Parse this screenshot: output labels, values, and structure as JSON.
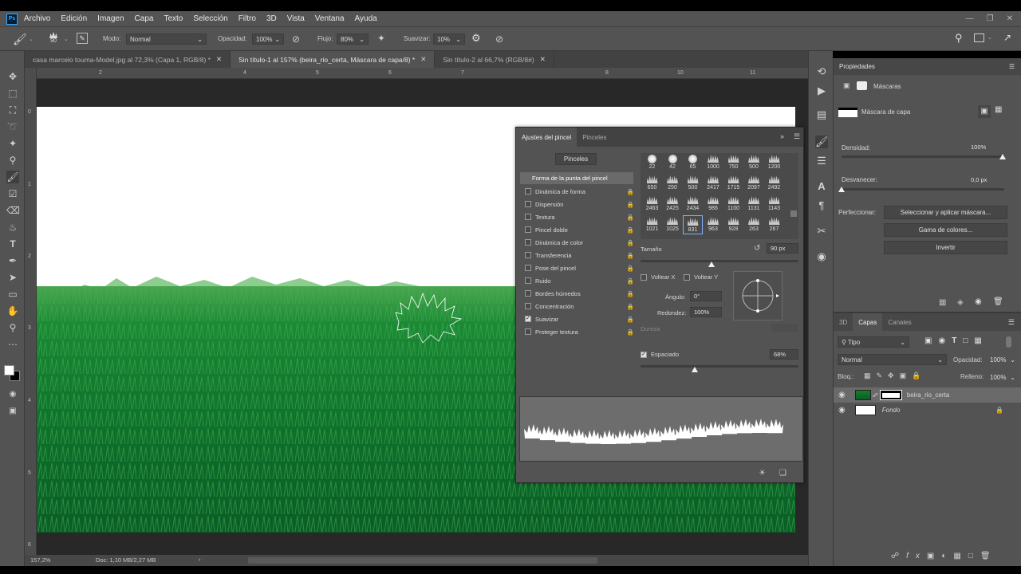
{
  "menu": {
    "app_icon": "Ps",
    "items": [
      "Archivo",
      "Edición",
      "Imagen",
      "Capa",
      "Texto",
      "Selección",
      "Filtro",
      "3D",
      "Vista",
      "Ventana",
      "Ayuda"
    ]
  },
  "options": {
    "brush_size": "90",
    "mode_label": "Modo:",
    "mode_value": "Normal",
    "opacity_label": "Opacidad:",
    "opacity_value": "100%",
    "flow_label": "Flujo:",
    "flow_value": "80%",
    "smoothing_label": "Suavizar:",
    "smoothing_value": "10%"
  },
  "tabs": [
    {
      "label": "casa marcelo touma-Model.jpg al 72,3% (Capa 1, RGB/8) *"
    },
    {
      "label": "Sin título-1 al 157% (beira_rio_certa, Máscara de capa/8) *"
    },
    {
      "label": "Sin título-2 al 66,7% (RGB/8#)"
    }
  ],
  "rulers": {
    "h": [
      "2",
      "4",
      "5",
      "6",
      "7",
      "8",
      "10",
      "11"
    ],
    "v": [
      "0",
      "1",
      "2",
      "3",
      "4",
      "5",
      "6"
    ]
  },
  "status": {
    "zoom": "157,2%",
    "doc": "Doc: 1,10 MB/2,27 MB"
  },
  "brush_panel": {
    "tab_settings": "Ajustes del pincel",
    "tab_brushes": "Pinceles",
    "brushes_button": "Pinceles",
    "tip_shape": "Forma de la punta del pincel",
    "options": [
      {
        "label": "Dinámica de forma",
        "checked": false
      },
      {
        "label": "Dispersión",
        "checked": false
      },
      {
        "label": "Textura",
        "checked": false
      },
      {
        "label": "Pincel doble",
        "checked": false
      },
      {
        "label": "Dinámica de color",
        "checked": false
      },
      {
        "label": "Transferencia",
        "checked": false
      },
      {
        "label": "Pose del pincel",
        "checked": false
      },
      {
        "label": "Ruido",
        "checked": false
      },
      {
        "label": "Bordes húmedos",
        "checked": false
      },
      {
        "label": "Concentración",
        "checked": false
      },
      {
        "label": "Suavizar",
        "checked": true
      },
      {
        "label": "Proteger textura",
        "checked": false
      }
    ],
    "tip_sizes": [
      [
        "22",
        "42",
        "65",
        "1000",
        "750",
        "500",
        "1200"
      ],
      [
        "650",
        "250",
        "500",
        "2417",
        "1715",
        "2097",
        "2492"
      ],
      [
        "2463",
        "2425",
        "2434",
        "986",
        "1100",
        "1131",
        "1143"
      ],
      [
        "1021",
        "1025",
        "831",
        "963",
        "928",
        "263",
        "267"
      ]
    ],
    "size_label": "Tamaño",
    "size_value": "90 px",
    "flip_x": "Voltear X",
    "flip_y": "Voltear Y",
    "angle_label": "Ángulo:",
    "angle_value": "0°",
    "roundness_label": "Redondez:",
    "roundness_value": "100%",
    "hardness_label": "Dureza",
    "spacing_label": "Espaciado",
    "spacing_value": "68%",
    "spacing_checked": true
  },
  "properties": {
    "title": "Propiedades",
    "section": "Máscaras",
    "mask_label": "Máscara de capa",
    "density_label": "Densidad:",
    "density_value": "100%",
    "feather_label": "Desvanecer:",
    "feather_value": "0,0 px",
    "refine_label": "Perfeccionar:",
    "select_mask_button": "Seleccionar y aplicar máscara...",
    "color_range_button": "Gama de colores...",
    "invert_button": "Invertir"
  },
  "layers": {
    "tabs": [
      "3D",
      "Capas",
      "Canales"
    ],
    "filter_value": "Tipo",
    "blend_value": "Normal",
    "opacity_label": "Opacidad:",
    "opacity_value": "100%",
    "lock_label": "Bloq.:",
    "fill_label": "Relleno:",
    "fill_value": "100%",
    "items": [
      {
        "name": "beira_rio_certa"
      },
      {
        "name": "Fondo"
      }
    ]
  },
  "colors": {
    "accent": "#31a8ff",
    "panel": "#535353",
    "grass": "#137a2f"
  }
}
